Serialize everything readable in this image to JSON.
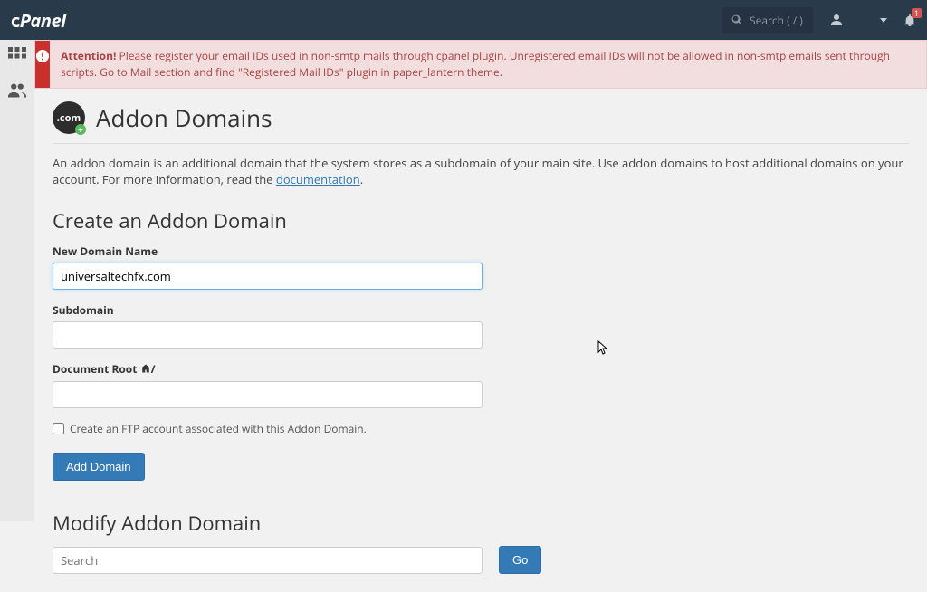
{
  "header": {
    "logo": "cPanel",
    "search_placeholder": "Search ( / )",
    "notif_count": "1"
  },
  "alert": {
    "bold": "Attention!",
    "text": "Please register your email IDs used in non-smtp mails through cpanel plugin. Unregistered email IDs will not be allowed in non-smtp emails sent through scripts. Go to Mail section and find \"Registered Mail IDs\" plugin in paper_lantern theme."
  },
  "page": {
    "icon_text": ".com",
    "title": "Addon Domains",
    "description_prefix": "An addon domain is an additional domain that the system stores as a subdomain of your main site. Use addon domains to host additional domains on your account. For more information, read the ",
    "doc_link": "documentation",
    "description_suffix": "."
  },
  "create": {
    "heading": "Create an Addon Domain",
    "new_domain_label": "New Domain Name",
    "new_domain_value": "universaltechfx.com",
    "subdomain_label": "Subdomain",
    "subdomain_value": "",
    "docroot_label": "Document Root ",
    "docroot_suffix": "/",
    "docroot_value": "",
    "ftp_checkbox_label": "Create an FTP account associated with this Addon Domain.",
    "submit": "Add Domain"
  },
  "modify": {
    "heading": "Modify Addon Domain",
    "search_placeholder": "Search",
    "go": "Go"
  }
}
